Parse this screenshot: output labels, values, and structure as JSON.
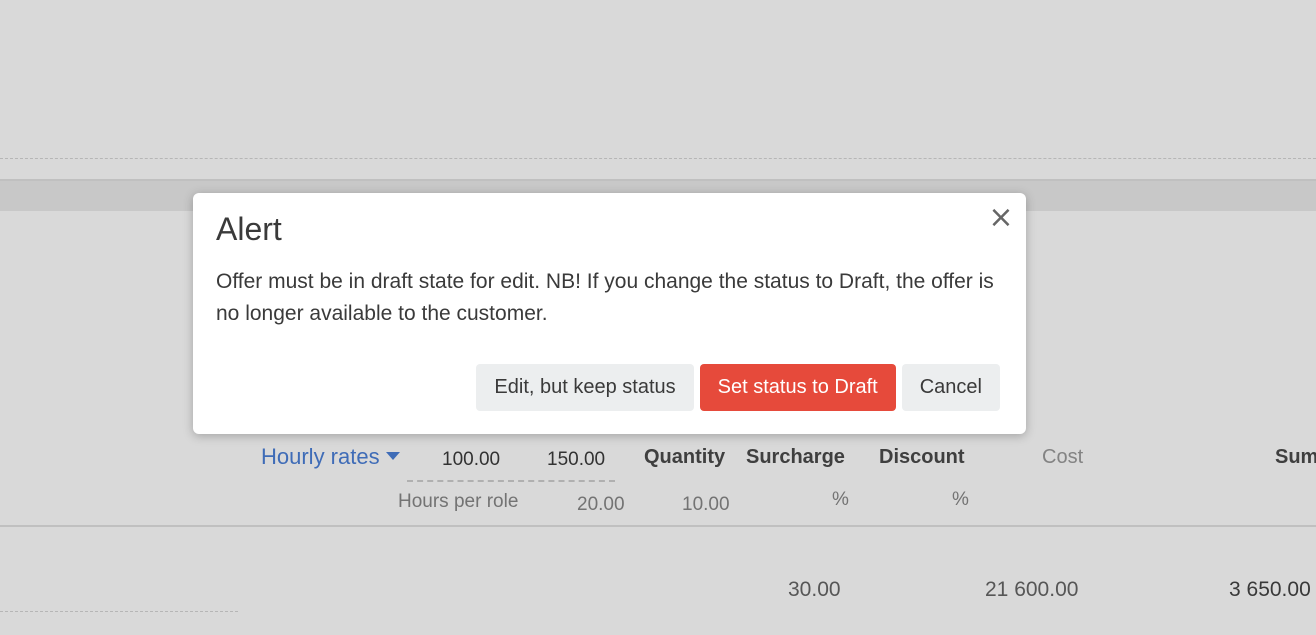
{
  "modal": {
    "title": "Alert",
    "close_symbol": "×",
    "close_icon": "close-icon",
    "message": "Offer must be in draft state for edit. NB! If you change the status to Draft, the offer is no longer available to the customer.",
    "buttons": {
      "edit_keep": "Edit, but keep status",
      "set_draft": "Set status to Draft",
      "cancel": "Cancel"
    }
  },
  "table_header": {
    "hourly_rates": "Hourly rates",
    "rate_1": "100.00",
    "rate_2": "150.00",
    "quantity": "Quantity",
    "surcharge": "Surcharge",
    "discount": "Discount",
    "cost": "Cost",
    "sum": "Sum",
    "hours_per_role": "Hours per role",
    "hours_1": "20.00",
    "hours_2": "10.00",
    "surcharge_unit": "%",
    "discount_unit": "%"
  },
  "table_row": {
    "value_1": "30.00",
    "value_2": "21 600.00",
    "value_3": "3 650.00"
  },
  "colors": {
    "danger": "#e64a3b",
    "link": "#4a7fd8",
    "overlay": "rgba(0,0,0,0.15)"
  }
}
